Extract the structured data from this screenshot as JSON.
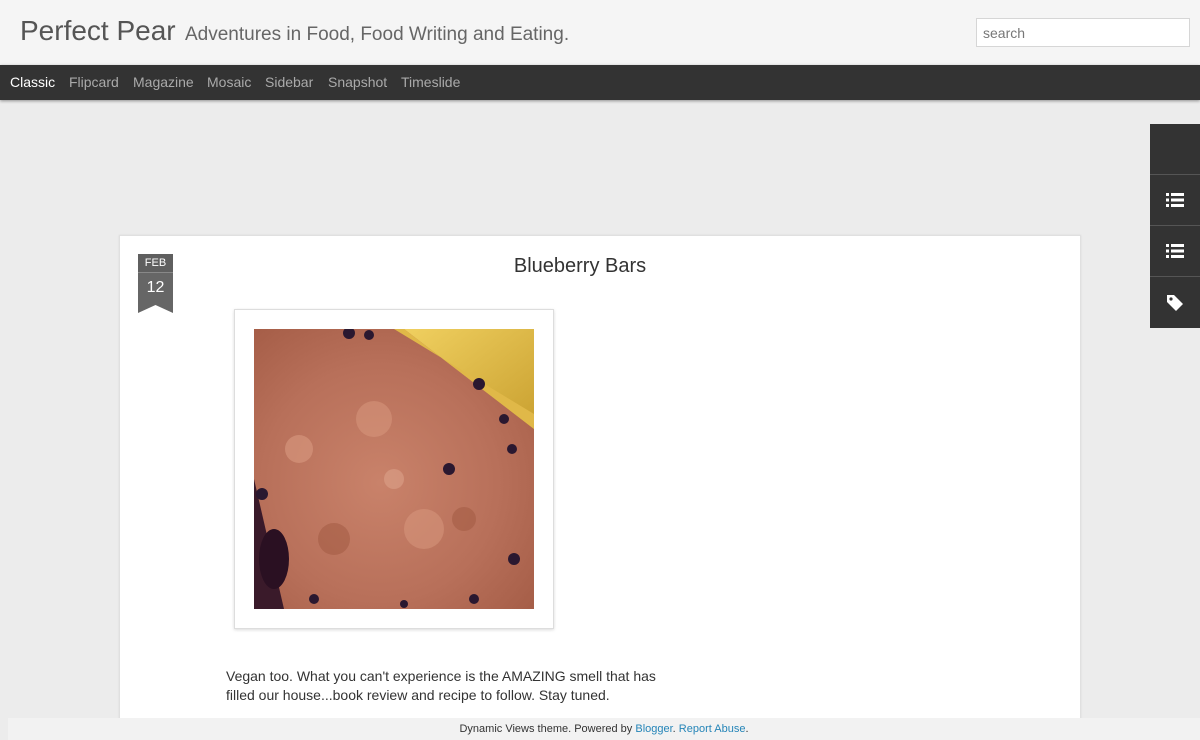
{
  "header": {
    "title": "Perfect Pear",
    "description": "Adventures in Food, Food Writing and Eating.",
    "search_placeholder": "search"
  },
  "nav": {
    "items": [
      "Classic",
      "Flipcard",
      "Magazine",
      "Mosaic",
      "Sidebar",
      "Snapshot",
      "Timeslide"
    ],
    "active": "Classic"
  },
  "side_tabs": {
    "icons": [
      "blank",
      "list-icon",
      "list-icon",
      "tag-icon"
    ]
  },
  "post": {
    "month": "FEB",
    "day": "12",
    "title": "Blueberry Bars",
    "body": "Vegan too. What you can't experience is the AMAZING smell that has filled our house...book review and recipe to follow. Stay tuned."
  },
  "footer": {
    "prefix": "Dynamic Views theme. Powered by ",
    "blogger_link": "Blogger",
    "separator": ". ",
    "report_link": "Report Abuse",
    "suffix": "."
  },
  "colors": {
    "nav_bg": "#333333",
    "accent_link": "#2585b8",
    "badge_bg": "#666666"
  }
}
